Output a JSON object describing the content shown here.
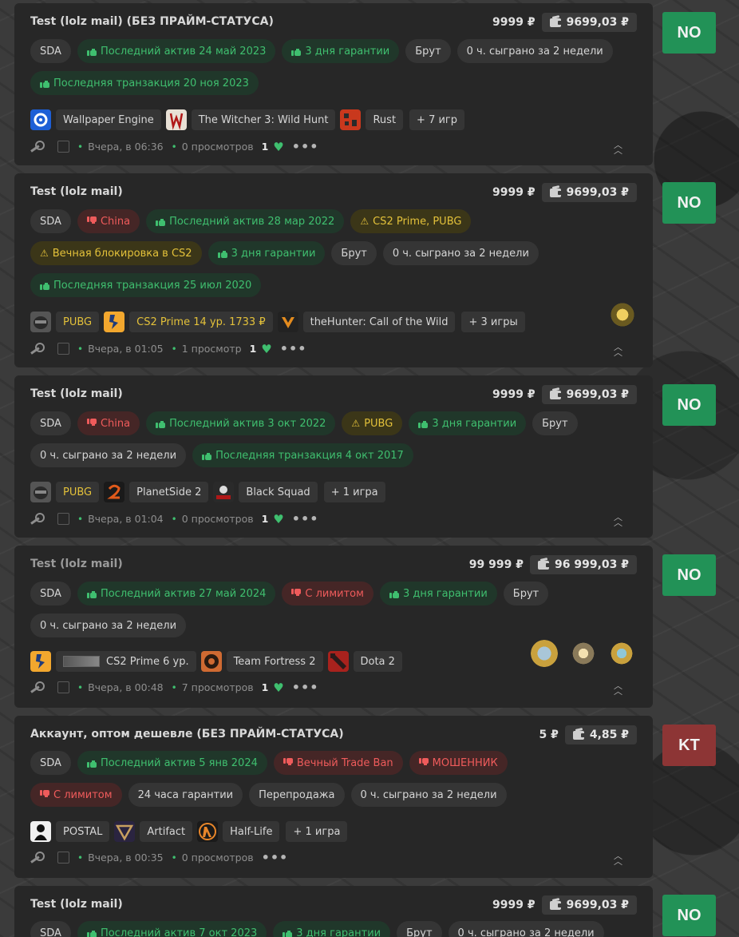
{
  "colors": {
    "green": "#3fbf6f",
    "red": "#ef5b5b",
    "yellow": "#e3c13a",
    "badge_no": "#229257",
    "badge_kt": "#8d3535"
  },
  "cards": [
    {
      "title": "Test (lolz mail) (БЕЗ ПРАЙМ-СТАТУСА)",
      "price": "9999 ₽",
      "price_box": "9699,03 ₽",
      "tags_row1": [
        "SDA",
        "Последний актив 24 май 2023",
        "3 дня гарантии",
        "Брут",
        "0 ч. сыграно за 2 недели"
      ],
      "tags_row2": [
        "Последняя транзакция 20 ноя 2023"
      ],
      "games": [
        "Wallpaper Engine",
        "The Witcher 3: Wild Hunt",
        "Rust",
        "+ 7 игр"
      ],
      "time": "Вчера, в 06:36",
      "views": "0 просмотров",
      "likes": "1",
      "badge": "NO"
    },
    {
      "title": "Test (lolz mail)",
      "price": "9999 ₽",
      "price_box": "9699,03 ₽",
      "tags_row1": [
        "SDA",
        "China",
        "Последний актив 28 мар 2022",
        "CS2 Prime, PUBG"
      ],
      "tags_row2": [
        "Вечная блокировка в CS2",
        "3 дня гарантии",
        "Брут",
        "0 ч. сыграно за 2 недели"
      ],
      "tags_row3": [
        "Последняя транзакция 25 июл 2020"
      ],
      "games": [
        "PUBG",
        "CS2 Prime 14 ур. 1733 ₽",
        "theHunter: Call of the Wild",
        "+ 3 игры"
      ],
      "time": "Вчера, в 01:05",
      "views": "1 просмотр",
      "likes": "1",
      "badge": "NO"
    },
    {
      "title": "Test (lolz mail)",
      "price": "9999 ₽",
      "price_box": "9699,03 ₽",
      "tags_row1": [
        "SDA",
        "China",
        "Последний актив 3 окт 2022",
        "PUBG",
        "3 дня гарантии",
        "Брут"
      ],
      "tags_row2": [
        "0 ч. сыграно за 2 недели",
        "Последняя транзакция 4 окт 2017"
      ],
      "games": [
        "PUBG",
        "PlanetSide 2",
        "Black Squad",
        "+ 1 игра"
      ],
      "time": "Вчера, в 01:04",
      "views": "0 просмотров",
      "likes": "1",
      "badge": "NO"
    },
    {
      "title": "Test (lolz mail)",
      "price": "99 999 ₽",
      "price_box": "96 999,03 ₽",
      "tags_row1": [
        "SDA",
        "Последний актив 27 май 2024",
        "С лимитом",
        "3 дня гарантии",
        "Брут"
      ],
      "tags_row2": [
        "0 ч. сыграно за 2 недели"
      ],
      "games": [
        "CS2 Prime 6 ур.",
        "Team Fortress 2",
        "Dota 2"
      ],
      "time": "Вчера, в 00:48",
      "views": "7 просмотров",
      "likes": "1",
      "badge": "NO"
    },
    {
      "title": "Аккаунт, оптом дешевле (БЕЗ ПРАЙМ-СТАТУСА)",
      "price": "5 ₽",
      "price_box": "4,85 ₽",
      "tags_row1": [
        "SDA",
        "Последний актив 5 янв 2024",
        "Вечный Trade Ban",
        "МОШЕННИК"
      ],
      "tags_row2": [
        "С лимитом",
        "24 часа гарантии",
        "Перепродажа",
        "0 ч. сыграно за 2 недели"
      ],
      "games": [
        "POSTAL",
        "Artifact",
        "Half-Life",
        "+ 1 игра"
      ],
      "time": "Вчера, в 00:35",
      "views": "0 просмотров",
      "badge": "KT"
    },
    {
      "title": "Test (lolz mail)",
      "price": "9999 ₽",
      "price_box": "9699,03 ₽",
      "tags_row1": [
        "SDA",
        "Последний актив 7 окт 2023",
        "3 дня гарантии",
        "Брут",
        "0 ч. сыграно за 2 недели"
      ],
      "badge": "NO"
    }
  ]
}
